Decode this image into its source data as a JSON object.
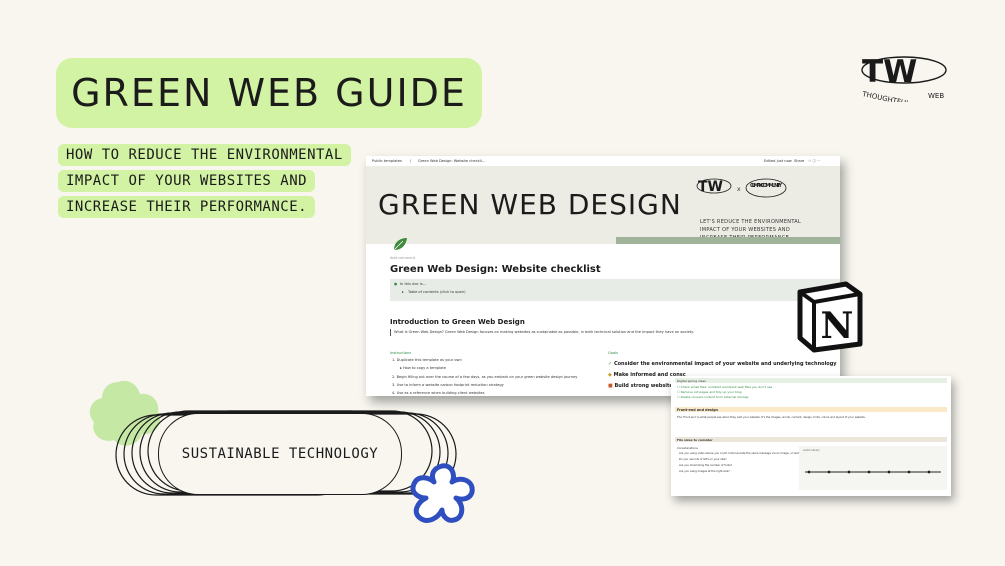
{
  "title": "GREEN WEB GUIDE",
  "subtitle_lines": [
    "HOW TO REDUCE THE ENVIRONMENTAL",
    "IMPACT OF YOUR WEBSITES AND",
    "INCREASE THEIR PERFORMANCE."
  ],
  "logo": {
    "initials": "TW",
    "wordmark_left": "THOUGHTFUL",
    "wordmark_right": "WEB"
  },
  "badge_label": "SUSTAINABLE TECHNOLOGY",
  "notion_logo_letter": "N",
  "screenshot_main": {
    "breadcrumb": [
      "Public templates",
      "/",
      "Green Web Design: Website checkli..."
    ],
    "toolbar_edited": "Edited just now",
    "toolbar_share": "Share",
    "cover_title": "GREEN WEB DESIGN",
    "cover_partner": "CLIMAX COMMUNITY",
    "cover_partner_x": "x",
    "cover_text": "LET'S REDUCE THE ENVIRONMENTAL IMPACT OF YOUR WEBSITES AND INCREASE THEIR PERFORMANCE.",
    "add_comment": "Add comment",
    "page_title": "Green Web Design: Website checklist",
    "callout_title": "In this doc is...",
    "callout_item": "Table of contents (click to open)",
    "section_title": "Introduction to Green Web Design",
    "intro_text": "What is Green Web Design? Green Web Design focuses on making websites as sustainable as possible, in both technical solution and the impact they have on society.",
    "instructions_heading": "Instructions",
    "instructions": [
      "1.  Duplicate this template as your own",
      "How to copy a template",
      "2.  Begin filling out over the course of a few days, as you embark on your green website design journey",
      "3.  Use to inform a website carbon footprint reduction strategy",
      "4.  Use as a reference when building client websites"
    ],
    "goals_heading": "Goals",
    "goals": [
      "Consider the environmental impact of your website and underlying technology",
      "Make informed and consc",
      "Build strong website prin"
    ]
  },
  "screenshot_secondary": {
    "todo_heading": "Digital spring clean",
    "todos": [
      "Check email files: unlinked and blank web files you don't use",
      "Remove old pages and tidy up your blog",
      "Delete unused content from external storage"
    ],
    "section_heading": "Front-end and design",
    "section_text": "The 'Front-end' is what people see when they visit your website. It's the images, words, content, design, fonts, colors and layout of your website.",
    "file_heading": "File sizes to consider",
    "considerations_label": "Considerations",
    "considerations": [
      "Are you using video where you could communicate the same message via an image, or text?",
      "Do you use lots of GIFs on your site?",
      "Are you minimizing the number of fonts?",
      "Are you using images at the right size?"
    ],
    "chart_label": "Audit Library"
  },
  "colors": {
    "background": "#f8f6ef",
    "accent_green": "#d2f3a3",
    "blob_green": "#c5e8a4",
    "flower_blue": "#2f4fc1"
  }
}
